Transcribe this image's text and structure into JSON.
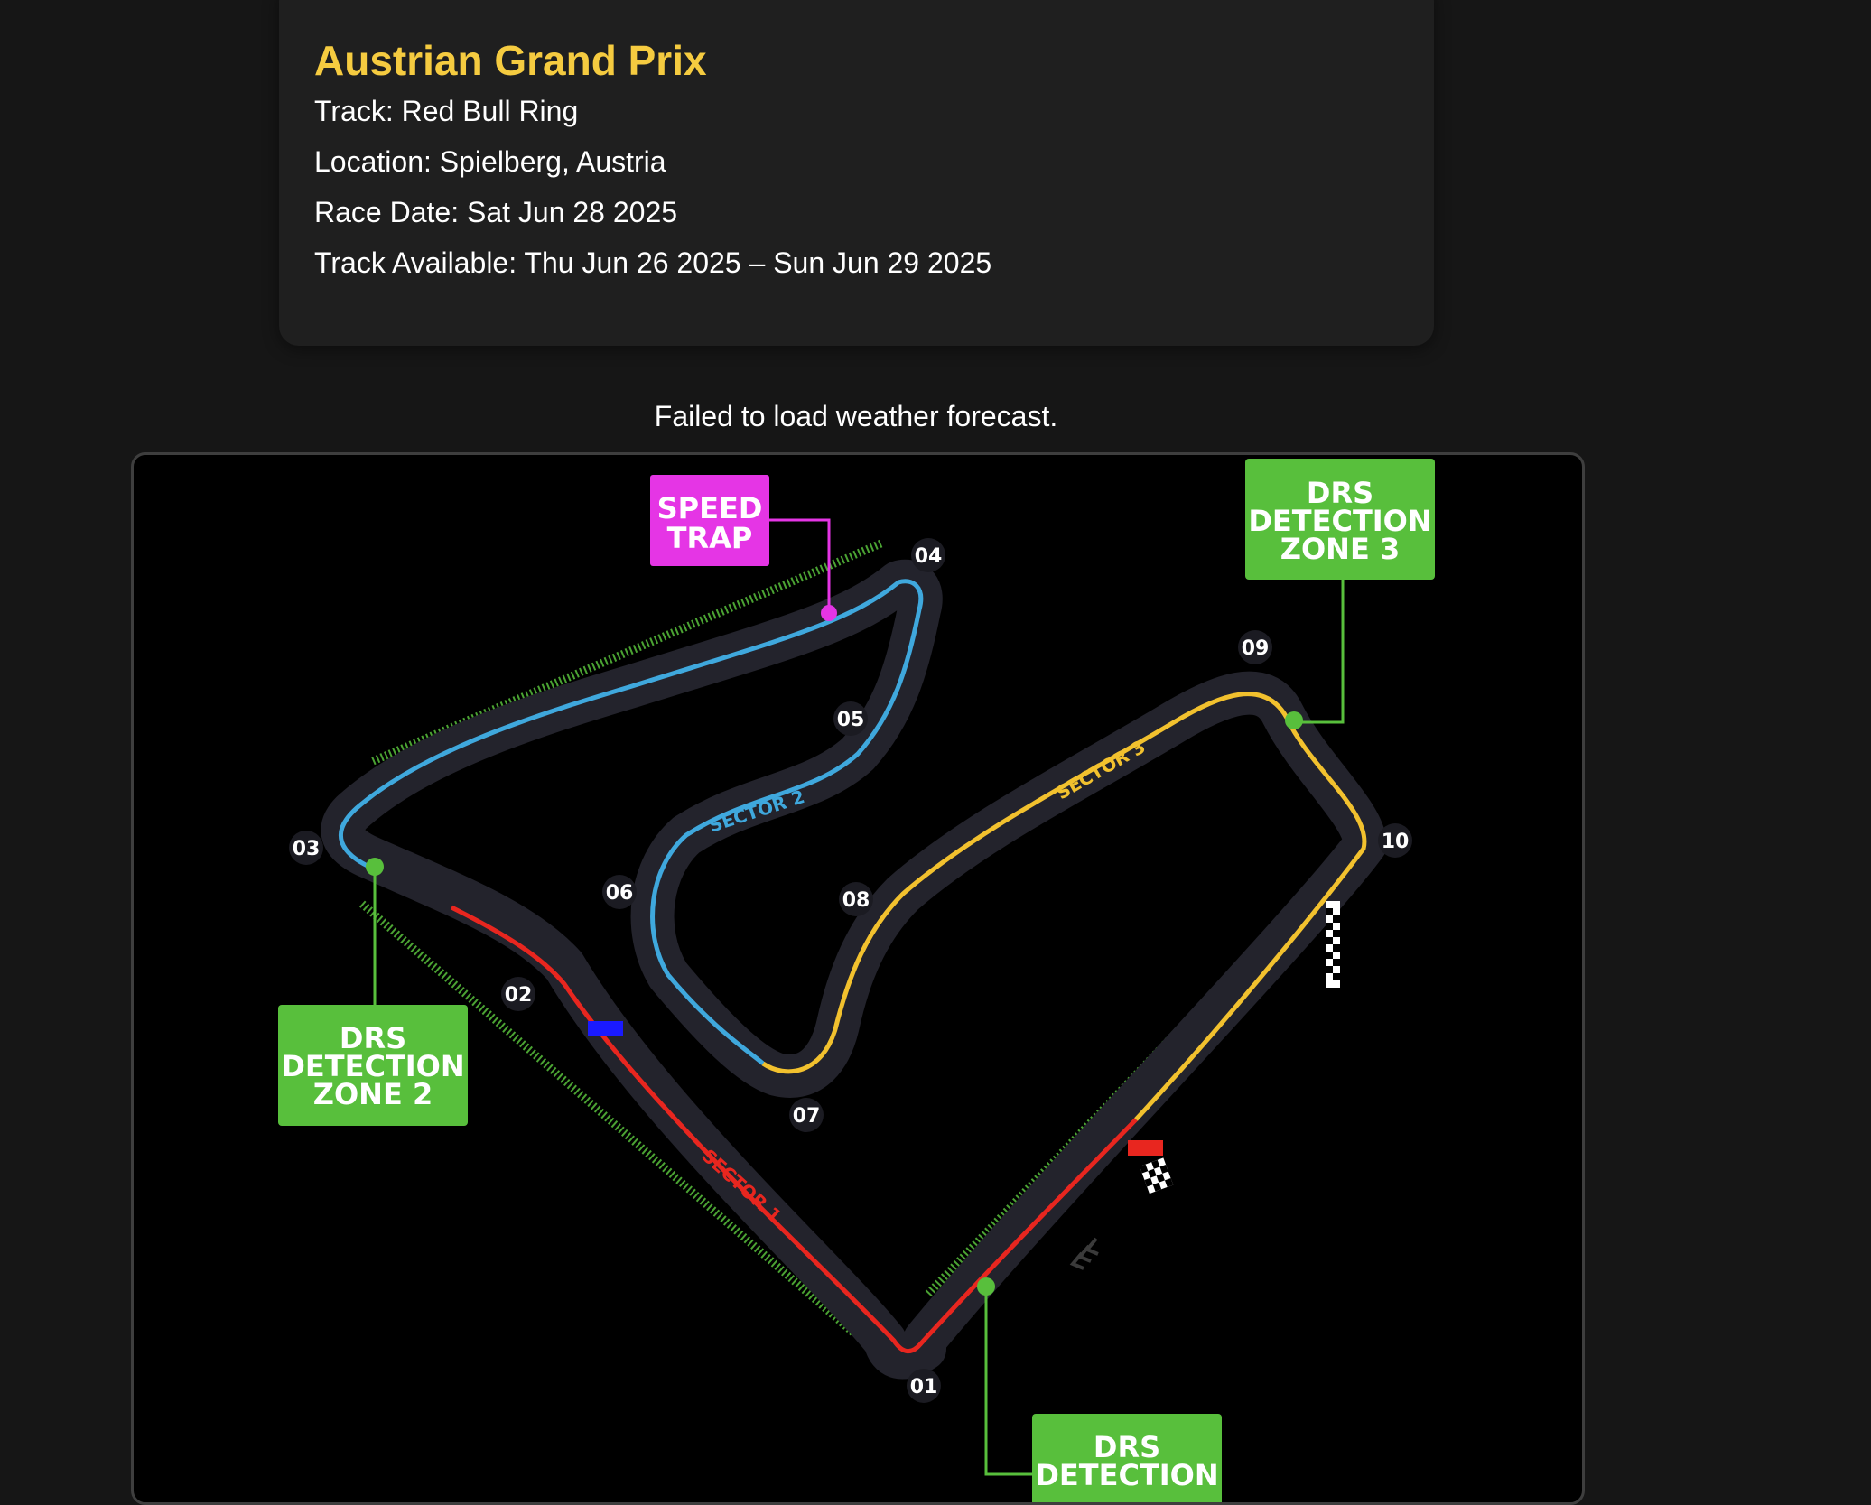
{
  "event": {
    "title": "Austrian Grand Prix",
    "track": "Track: Red Bull Ring",
    "location": "Location: Spielberg, Austria",
    "race_date": "Race Date: Sat Jun 28 2025",
    "track_available": "Track Available: Thu Jun 26 2025 – Sun Jun 29 2025"
  },
  "weather": {
    "message": "Failed to load weather forecast."
  },
  "track_map": {
    "turns": [
      "01",
      "02",
      "03",
      "04",
      "05",
      "06",
      "07",
      "08",
      "09",
      "10"
    ],
    "sectors": [
      "SECTOR 1",
      "SECTOR 2",
      "SECTOR 3"
    ],
    "speed_trap": [
      "SPEED",
      "TRAP"
    ],
    "drs_zone_2": [
      "DRS",
      "DETECTION",
      "ZONE 2"
    ],
    "drs_zone_3": [
      "DRS",
      "DETECTION",
      "ZONE 3"
    ],
    "drs_zone_1": [
      "DRS",
      "DETECTION"
    ],
    "colors": {
      "sector1": "#e8261f",
      "sector2": "#3fa8dd",
      "sector3": "#f2c12e",
      "drs": "#58bf3c",
      "speed_trap": "#e535e5",
      "track_edge": "#23232c",
      "title": "#f5cb40"
    }
  }
}
